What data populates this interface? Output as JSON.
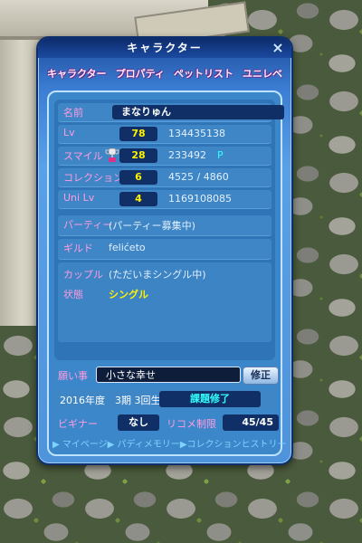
{
  "window": {
    "title": "キャラクター",
    "close_glyph": "×"
  },
  "tabs": [
    "キャラクター",
    "プロパティ",
    "ペットリスト",
    "ユニレベ"
  ],
  "profile": {
    "name": {
      "label": "名前",
      "value": "まなりゅん"
    },
    "lv": {
      "label": "Lv",
      "value": "78",
      "exp": "134435138"
    },
    "smile": {
      "label": "スマイル",
      "value": "28",
      "points": "233492",
      "unit": "P"
    },
    "collection": {
      "label": "コレクション",
      "value": "6",
      "progress": "4525 / 4860"
    },
    "uni_lv": {
      "label": "Uni Lv",
      "value": "4",
      "exp": "1169108085"
    },
    "party": {
      "label": "パーティー",
      "value": "(パーティー募集中)"
    },
    "guild": {
      "label": "ギルド",
      "value": "felićeto"
    },
    "couple": {
      "label": "カップル",
      "value": "(ただいまシングル中)"
    },
    "status": {
      "label": "状態",
      "value": "シングル"
    }
  },
  "wish": {
    "label": "願い事",
    "value": "小さな幸せ",
    "button": "修正"
  },
  "term": {
    "text": "2016年度　3期 3回生",
    "result": "課題修了"
  },
  "beginner": {
    "label": "ビギナー",
    "value": "なし"
  },
  "recommend": {
    "label": "リコメ制限",
    "value": "45/45"
  },
  "links": [
    "▶ マイページ",
    "▶ パディメモリー",
    "▶コレクションヒストリー"
  ],
  "colors": {
    "accent": "#3ff",
    "label_pink": "#ff9ce0",
    "panel_blue": "#3c87c9"
  }
}
